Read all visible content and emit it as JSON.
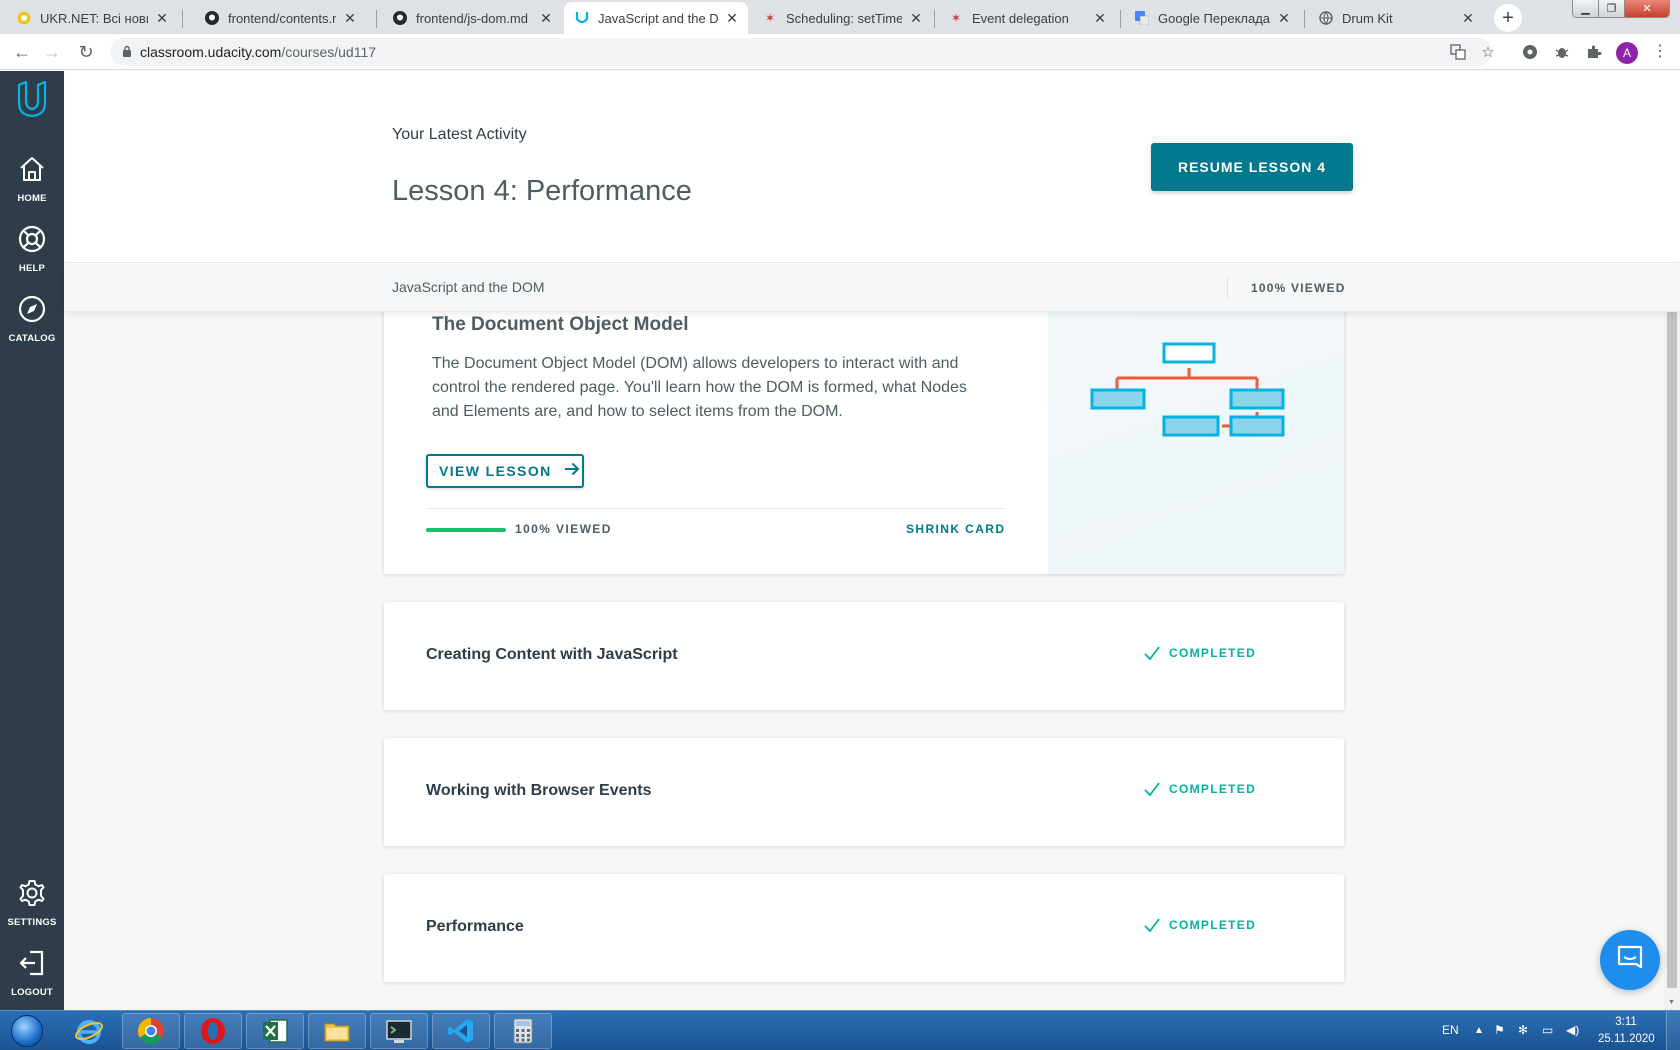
{
  "browser": {
    "tabs": [
      {
        "title": "UKR.NET: Всі новини України",
        "active": false,
        "favicon": "ukrnet-icon"
      },
      {
        "title": "frontend/contents.md at master",
        "active": false,
        "favicon": "github-icon"
      },
      {
        "title": "frontend/js-dom.md at master",
        "active": false,
        "favicon": "github-icon"
      },
      {
        "title": "JavaScript and the DOM",
        "active": true,
        "favicon": "udacity-icon"
      },
      {
        "title": "Scheduling: setTimeout",
        "active": false,
        "favicon": "javascript-info-icon"
      },
      {
        "title": "Event delegation",
        "active": false,
        "favicon": "javascript-info-icon"
      },
      {
        "title": "Google Перекладач",
        "active": false,
        "favicon": "google-translate-icon"
      },
      {
        "title": "Drum Kit",
        "active": false,
        "favicon": "globe-icon"
      }
    ],
    "new_tab_label": "+",
    "url_host": "classroom.udacity.com",
    "url_path": "/courses/ud117",
    "profile_initial": "A"
  },
  "sidebar": {
    "items": [
      {
        "label": "HOME",
        "icon": "home-icon"
      },
      {
        "label": "HELP",
        "icon": "lifebuoy-icon"
      },
      {
        "label": "CATALOG",
        "icon": "compass-icon"
      },
      {
        "label": "SETTINGS",
        "icon": "gear-icon"
      },
      {
        "label": "LOGOUT",
        "icon": "logout-icon"
      }
    ]
  },
  "header": {
    "latest_activity_label": "Your Latest Activity",
    "lesson_title": "Lesson 4: Performance",
    "resume_button": "RESUME LESSON 4"
  },
  "subbar": {
    "course_name": "JavaScript and the DOM",
    "viewed": "100% VIEWED"
  },
  "open_card": {
    "title": "The Document Object Model",
    "description": "The Document Object Model (DOM) allows developers to interact with and control the rendered page. You'll learn how the DOM is formed, what Nodes and Elements are, and how to select items from the DOM.",
    "view_button": "VIEW LESSON",
    "progress_fraction": 1.0,
    "progress_text": "100% VIEWED",
    "shrink_label": "SHRINK CARD",
    "illustration": "dom-tree-illustration"
  },
  "lessons": [
    {
      "title": "Creating Content with JavaScript",
      "status": "COMPLETED"
    },
    {
      "title": "Working with Browser Events",
      "status": "COMPLETED"
    },
    {
      "title": "Performance",
      "status": "COMPLETED"
    }
  ],
  "taskbar": {
    "apps": [
      "internet-explorer-icon",
      "chrome-icon",
      "opera-icon",
      "excel-icon",
      "file-explorer-icon",
      "terminal-icon",
      "vscode-icon",
      "calculator-icon"
    ],
    "language": "EN",
    "time": "3:11",
    "date": "25.11.2020"
  },
  "colors": {
    "udacity_dark": "#2e3d49",
    "accent_teal": "#02788c",
    "completed_green": "#02b3a5",
    "progress_green": "#15c26b"
  }
}
